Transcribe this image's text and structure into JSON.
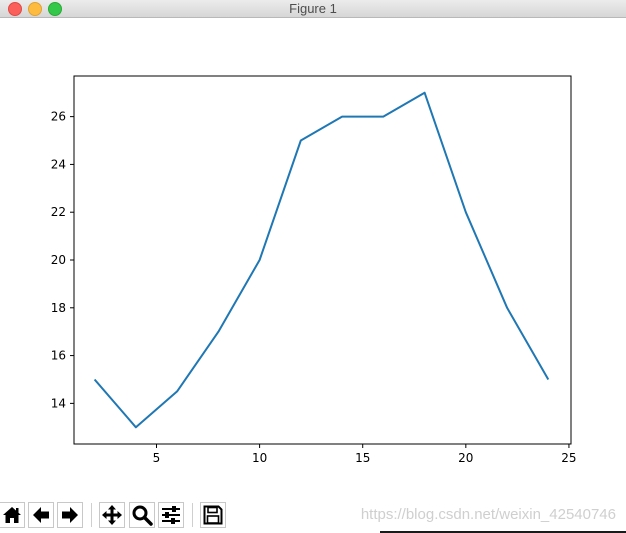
{
  "window": {
    "title": "Figure 1"
  },
  "chart_data": {
    "type": "line",
    "x": [
      2,
      4,
      6,
      8,
      10,
      12,
      14,
      16,
      18,
      20,
      22,
      24
    ],
    "series": [
      {
        "values": [
          15,
          13,
          14.5,
          17,
          20,
          25,
          26,
          26,
          27,
          22,
          18,
          15
        ],
        "color": "#1f77b4"
      }
    ],
    "xticks": [
      5,
      10,
      15,
      20,
      25
    ],
    "yticks": [
      14,
      16,
      18,
      20,
      22,
      24,
      26
    ],
    "xlim": [
      1.0,
      25.1
    ],
    "ylim": [
      12.3,
      27.7
    ],
    "title": "",
    "xlabel": "",
    "ylabel": "",
    "grid": false
  },
  "toolbar": {
    "buttons": [
      {
        "name": "home-button",
        "icon": "home-icon"
      },
      {
        "name": "back-button",
        "icon": "arrow-left-icon"
      },
      {
        "name": "forward-button",
        "icon": "arrow-right-icon"
      },
      {
        "name": "pan-button",
        "icon": "move-icon"
      },
      {
        "name": "zoom-button",
        "icon": "magnifier-icon"
      },
      {
        "name": "configure-subplots-button",
        "icon": "sliders-icon"
      },
      {
        "name": "save-button",
        "icon": "floppy-disk-icon"
      }
    ]
  },
  "watermark": "https://blog.csdn.net/weixin_42540746"
}
